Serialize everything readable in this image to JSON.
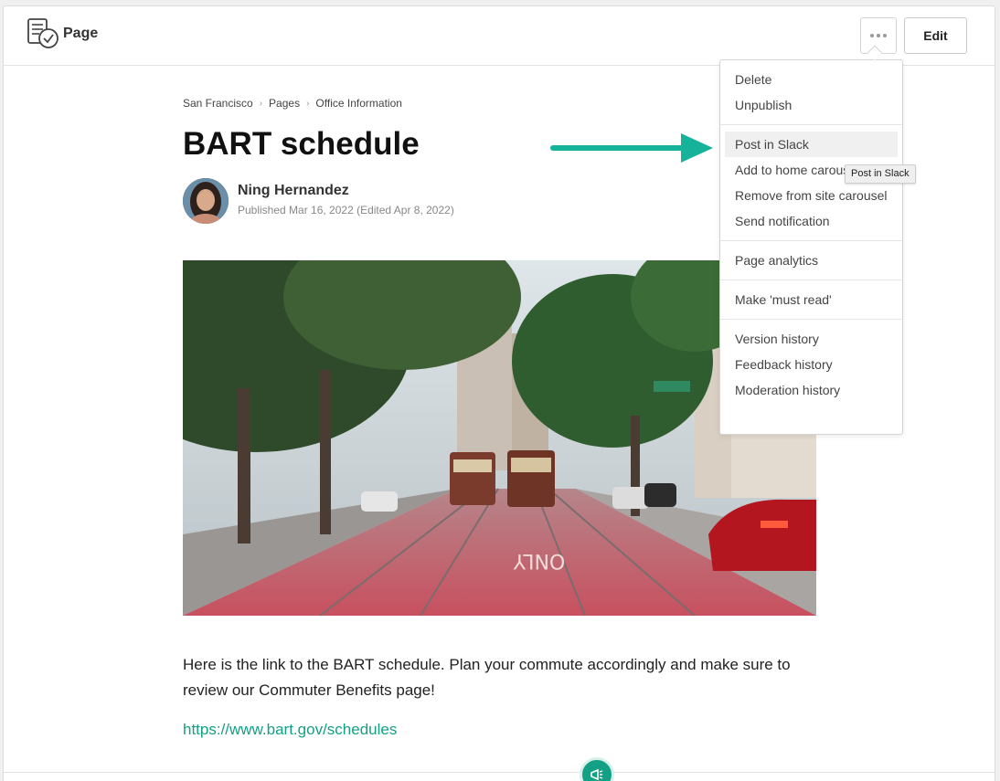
{
  "header": {
    "title": "Page",
    "more_label": "More options",
    "edit_label": "Edit"
  },
  "breadcrumb": [
    "San Francisco",
    "Pages",
    "Office Information"
  ],
  "article": {
    "title": "BART schedule",
    "author": "Ning Hernandez",
    "published": "Published Mar 16, 2022 (Edited Apr 8, 2022)",
    "body": "Here is the link to the BART schedule. Plan your commute accordingly and make sure to review our Commuter Benefits page!",
    "link": "https://www.bart.gov/schedules"
  },
  "menu": {
    "groups": [
      [
        "Delete",
        "Unpublish"
      ],
      [
        "Post in Slack",
        "Add to home carousel",
        "Remove from site carousel",
        "Send notification"
      ],
      [
        "Page analytics"
      ],
      [
        "Make 'must read'"
      ],
      [
        "Version history",
        "Feedback history",
        "Moderation history"
      ]
    ],
    "hovered": "Post in Slack"
  },
  "tooltip": "Post in Slack",
  "colors": {
    "accent": "#14a085",
    "arrow": "#14b39a"
  },
  "icons": {
    "page": "page-check-icon",
    "fab": "megaphone-icon"
  }
}
